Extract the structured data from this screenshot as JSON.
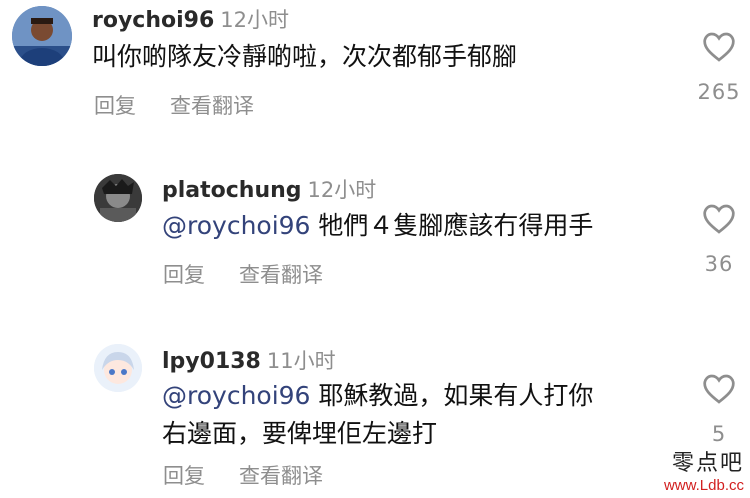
{
  "comments": [
    {
      "username": "roychoi96",
      "time": "12小时",
      "mention": "",
      "text_lines": [
        "叫你啲隊友冷靜啲啦，次次都郁手郁腳"
      ],
      "actions": {
        "reply": "回复",
        "translate": "查看翻译"
      },
      "likes": "265"
    },
    {
      "username": "platochung",
      "time": "12小时",
      "mention": "@roychoi96",
      "text_lines": [
        "牠們４隻腳應該冇得用手"
      ],
      "actions": {
        "reply": "回复",
        "translate": "查看翻译"
      },
      "likes": "36"
    },
    {
      "username": "lpy0138",
      "time": "11小时",
      "mention": "@roychoi96",
      "text_lines": [
        "耶穌教過，如果有人打你",
        "右邊面，要俾埋佢左邊打"
      ],
      "actions": {
        "reply": "回复",
        "translate": "查看翻译"
      },
      "likes": "5"
    }
  ],
  "watermark": {
    "line1": "零点吧",
    "line2": "www.Ldb.cc"
  },
  "colors": {
    "mention": "#33437a",
    "secondary": "#8e8e8e",
    "watermark_url": "#d22020"
  }
}
